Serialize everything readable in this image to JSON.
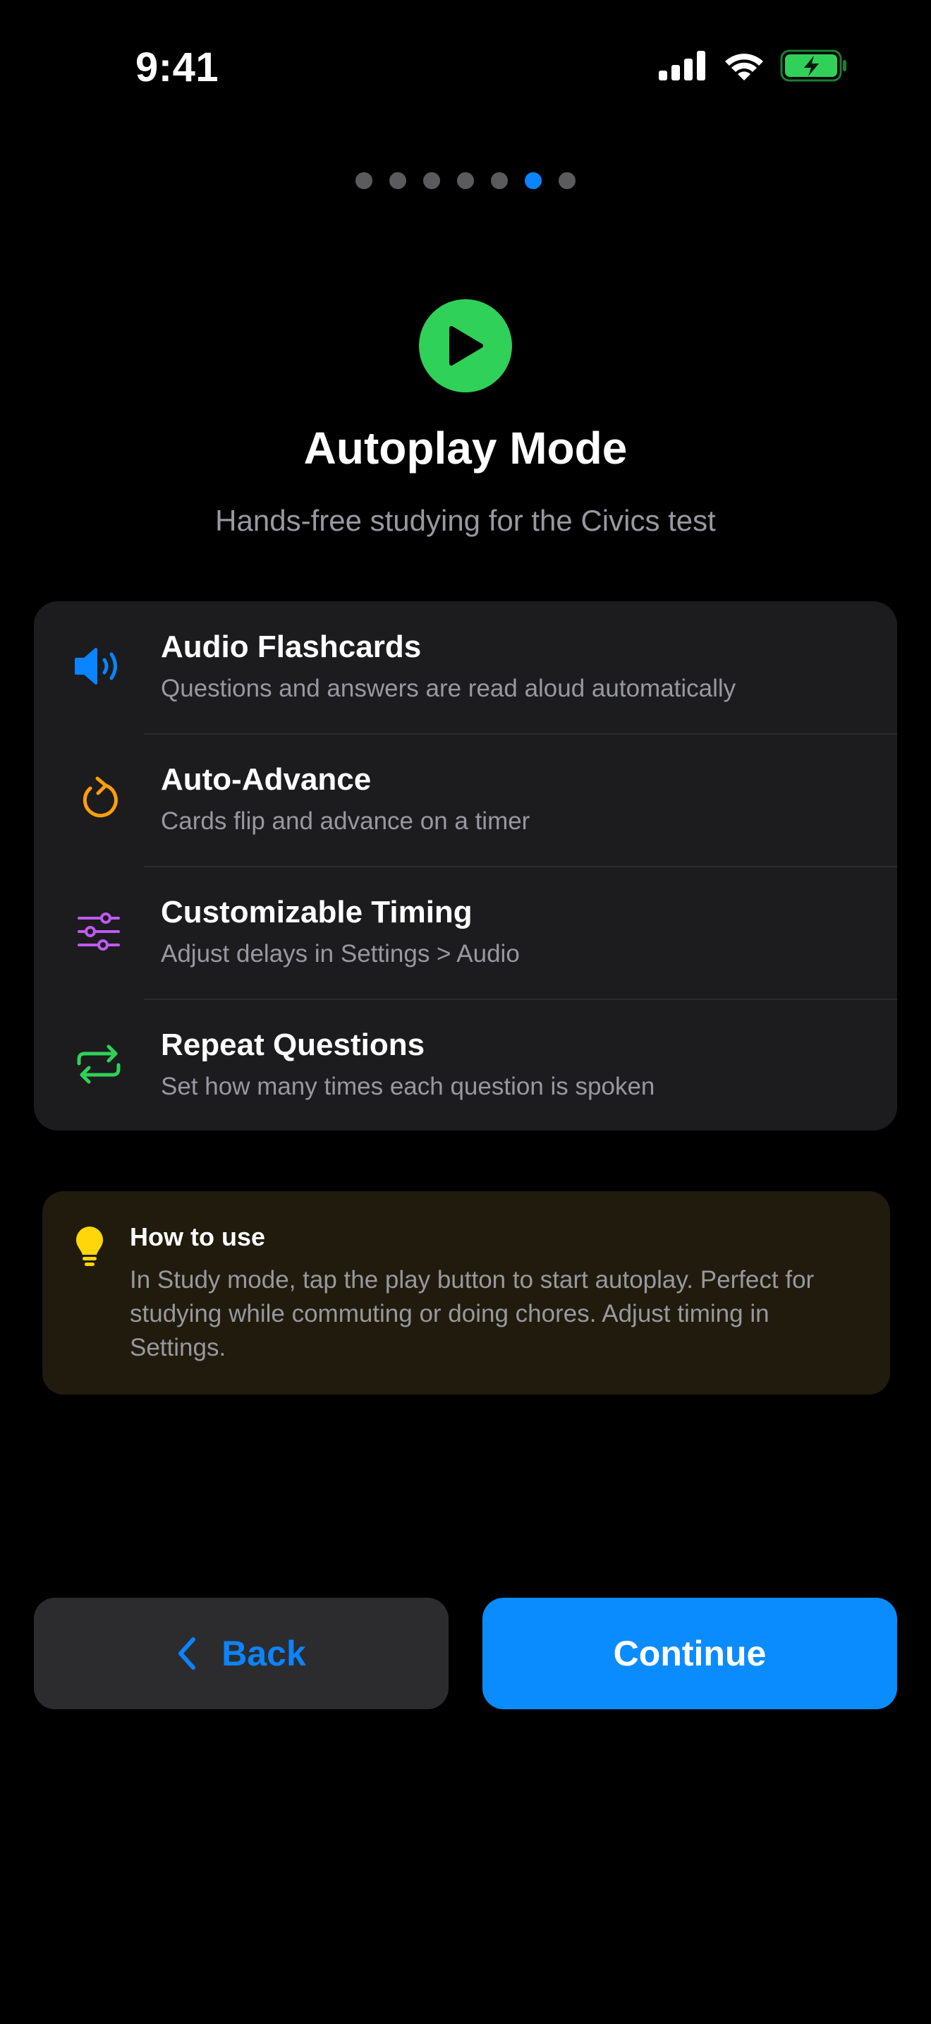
{
  "status_bar": {
    "time": "9:41"
  },
  "pager": {
    "count": 7,
    "active_index": 5
  },
  "hero": {
    "icon": "play-circle-icon",
    "icon_color": "#30d158",
    "title": "Autoplay Mode",
    "subtitle": "Hands-free studying for the Civics test"
  },
  "features": [
    {
      "icon": "speaker-wave-icon",
      "icon_color": "#0a84ff",
      "title": "Audio Flashcards",
      "description": "Questions and answers are read aloud automatically"
    },
    {
      "icon": "refresh-arrow-icon",
      "icon_color": "#ff9f0a",
      "title": "Auto-Advance",
      "description": "Cards flip and advance on a timer"
    },
    {
      "icon": "sliders-icon",
      "icon_color": "#bf5af2",
      "title": "Customizable Timing",
      "description": "Adjust delays in Settings > Audio"
    },
    {
      "icon": "repeat-icon",
      "icon_color": "#30d158",
      "title": "Repeat Questions",
      "description": "Set how many times each question is spoken"
    }
  ],
  "tip": {
    "icon": "lightbulb-icon",
    "icon_color": "#ffd60a",
    "title": "How to use",
    "body": "In Study mode, tap the play button to start autoplay. Perfect for studying while commuting or doing chores. Adjust timing in Settings."
  },
  "buttons": {
    "back_label": "Back",
    "continue_label": "Continue",
    "accent": "#0a84ff"
  }
}
